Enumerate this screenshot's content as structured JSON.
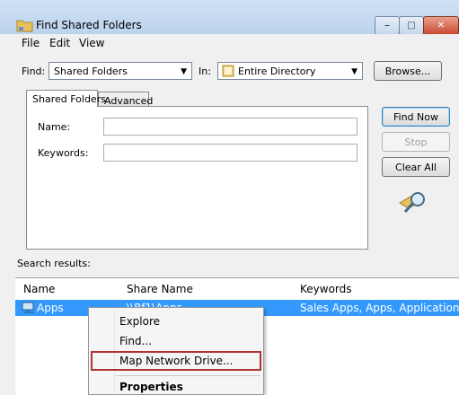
{
  "window": {
    "title": "Find Shared Folders",
    "icon": "shared-folder-icon",
    "controls": {
      "minimize": "minimize-icon",
      "maximize": "maximize-icon",
      "close": "close-icon"
    }
  },
  "menu": {
    "items": [
      "File",
      "Edit",
      "View"
    ]
  },
  "find": {
    "find_label": "Find:",
    "find_value": "Shared Folders",
    "in_label": "In:",
    "in_value": "Entire Directory",
    "in_icon": "directory-icon",
    "browse_label": "Browse..."
  },
  "tabs": [
    "Shared Folders",
    "Advanced"
  ],
  "form": {
    "name_label": "Name:",
    "name_value": "",
    "keywords_label": "Keywords:",
    "keywords_value": ""
  },
  "buttons": {
    "find_now": "Find Now",
    "stop": "Stop",
    "clear_all": "Clear All"
  },
  "search_icon": "magnifier-folder-icon",
  "results": {
    "label": "Search results:",
    "columns": [
      "Name",
      "Share Name",
      "Keywords"
    ],
    "rows": [
      {
        "name": "Apps",
        "share": "\\\\Bf1\\Apps",
        "keywords": "Sales Apps, Apps, Applications",
        "icon": "network-share-icon",
        "selected": true
      }
    ]
  },
  "context_menu": {
    "items": [
      "Explore",
      "Find...",
      "Map Network Drive...",
      "Properties"
    ],
    "highlighted": "Map Network Drive...",
    "bold": "Properties"
  },
  "colors": {
    "selection": "#3399ff",
    "highlight_border": "#b0332e"
  }
}
